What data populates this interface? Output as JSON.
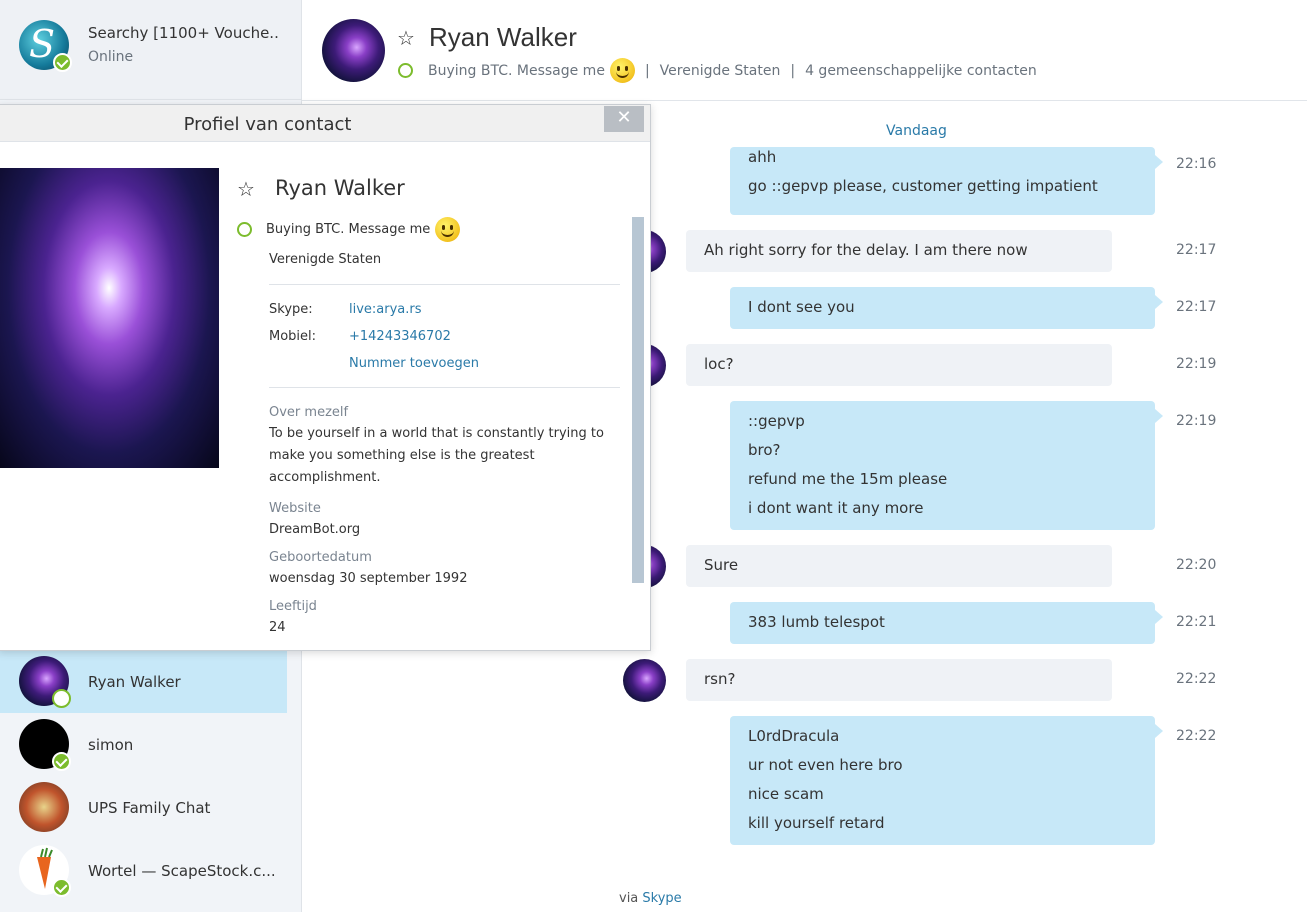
{
  "me": {
    "name": "Searchy [1100+ Vouche...",
    "status": "Online"
  },
  "header": {
    "star": "☆",
    "title": "Ryan Walker",
    "mood": "Buying BTC. Message me",
    "country": "Verenigde Staten",
    "mutual": "4 gemeenschappelijke contacten",
    "separator": "|"
  },
  "profile": {
    "title": "Profiel van contact",
    "close": "✕",
    "name": "Ryan Walker",
    "mood": "Buying BTC. Message me",
    "country": "Verenigde Staten",
    "skype_label": "Skype:",
    "skype_value": "live:arya.rs",
    "mobile_label": "Mobiel:",
    "mobile_value": "+14243346702",
    "add_number": "Nummer toevoegen",
    "about_label": "Over mezelf",
    "about_text": "To be yourself in a world that is constantly trying to make you something else is the greatest accomplishment.",
    "website_label": "Website",
    "website_value": "DreamBot.org",
    "birthday_label": "Geboortedatum",
    "birthday_value": "woensdag 30 september 1992",
    "age_label": "Leeftijd",
    "age_value": "24"
  },
  "contacts": [
    {
      "name": "Ryan Walker"
    },
    {
      "name": "simon"
    },
    {
      "name": "UPS Family Chat"
    },
    {
      "name": "Wortel — ScapeStock.c..."
    }
  ],
  "chat": {
    "date_label": "Vandaag",
    "messages": [
      {
        "dir": "out",
        "lines": [
          "ahh",
          "go ::gepvp please, customer getting impatient"
        ],
        "time": "22:16"
      },
      {
        "dir": "in",
        "lines": [
          "Ah right sorry for the delay. I am there now"
        ],
        "time": "22:17"
      },
      {
        "dir": "out",
        "lines": [
          "I dont see you"
        ],
        "time": "22:17"
      },
      {
        "dir": "in",
        "lines": [
          "loc?"
        ],
        "time": "22:19"
      },
      {
        "dir": "out",
        "lines": [
          "::gepvp",
          "bro?",
          "refund me the 15m please",
          "i dont want it any more"
        ],
        "time": "22:19"
      },
      {
        "dir": "in",
        "lines": [
          "Sure"
        ],
        "time": "22:20"
      },
      {
        "dir": "out",
        "lines": [
          "383 lumb telespot"
        ],
        "time": "22:21"
      },
      {
        "dir": "in",
        "lines": [
          "rsn?"
        ],
        "time": "22:22"
      },
      {
        "dir": "out",
        "lines": [
          "L0rdDracula",
          "ur not even here bro",
          "nice scam",
          "kill yourself retard"
        ],
        "time": "22:22"
      }
    ],
    "via_label": "via",
    "via_link": "Skype"
  }
}
